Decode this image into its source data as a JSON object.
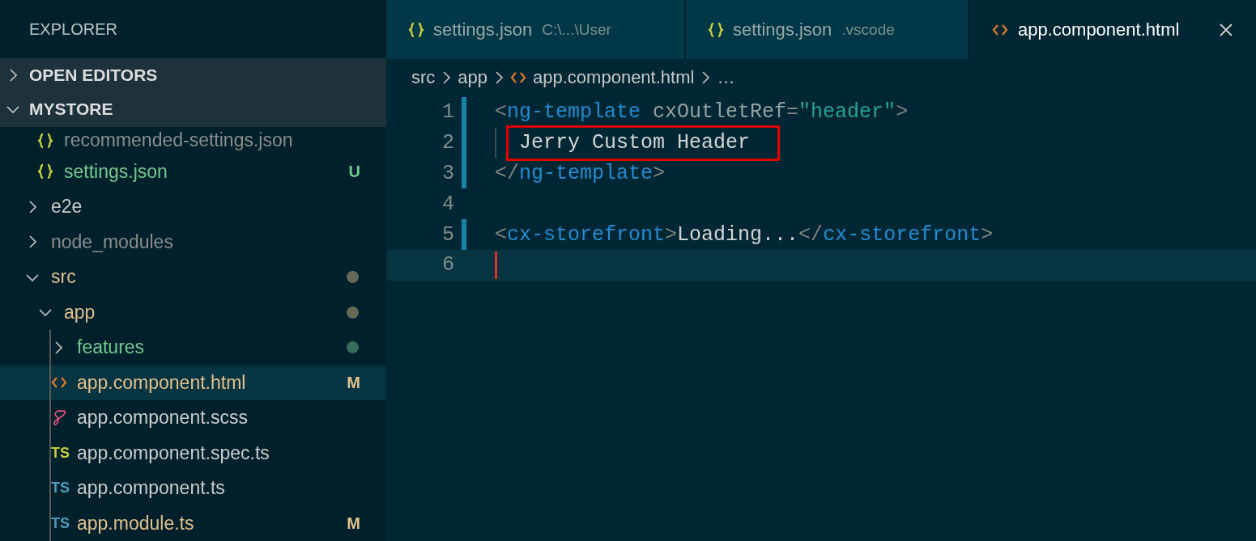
{
  "sidebar": {
    "title": "EXPLORER",
    "sections": [
      {
        "label": "OPEN EDITORS",
        "expanded": false
      },
      {
        "label": "MYSTORE",
        "expanded": true
      }
    ],
    "tree_continued": [
      {
        "name": "recommended-settings.json",
        "kind": "json-file",
        "color": "#8c8c8c",
        "selected": false
      },
      {
        "name": "settings.json",
        "kind": "json-file",
        "color": "#73c991",
        "badge": "U",
        "selected": false
      }
    ],
    "tree": [
      {
        "name": "e2e",
        "kind": "folder",
        "expanded": false,
        "color": "#cccccc",
        "selected": false
      },
      {
        "name": "node_modules",
        "kind": "folder",
        "expanded": false,
        "color": "#8c8c8c",
        "selected": false
      },
      {
        "name": "src",
        "kind": "folder",
        "expanded": true,
        "color": "#e2c08d",
        "dot": true,
        "selected": false,
        "children": [
          {
            "name": "app",
            "kind": "folder",
            "expanded": true,
            "color": "#e2c08d",
            "dot": true,
            "selected": false,
            "children": [
              {
                "name": "features",
                "kind": "folder",
                "expanded": false,
                "color": "#73c991",
                "dot": true,
                "selected": false
              },
              {
                "name": "app.component.html",
                "kind": "html-file",
                "color": "#e2c08d",
                "badge": "M",
                "selected": true
              },
              {
                "name": "app.component.scss",
                "kind": "scss-file",
                "color": "#cccccc",
                "selected": false
              },
              {
                "name": "app.component.spec.ts",
                "kind": "ts-spec-file",
                "icon_label": "TS",
                "color": "#cccccc",
                "selected": false
              },
              {
                "name": "app.component.ts",
                "kind": "ts-file",
                "icon_label": "TS",
                "color": "#cccccc",
                "selected": false
              },
              {
                "name": "app.module.ts",
                "kind": "ts-file",
                "icon_label": "TS",
                "color": "#e2c08d",
                "badge": "M",
                "selected": false
              }
            ]
          }
        ]
      }
    ]
  },
  "tabs": [
    {
      "label": "settings.json",
      "description": "C:\\...\\User",
      "kind": "json-file",
      "selected": false
    },
    {
      "label": "settings.json",
      "description": ".vscode",
      "kind": "json-file",
      "selected": false
    },
    {
      "label": "app.component.html",
      "kind": "html-file",
      "selected": true
    }
  ],
  "breadcrumb": [
    {
      "label": "src",
      "kind": "folder"
    },
    {
      "label": "app",
      "kind": "folder"
    },
    {
      "label": "app.component.html",
      "kind": "html-file"
    },
    {
      "label": "…",
      "kind": "more"
    }
  ],
  "code_lines": [
    {
      "number": "1",
      "changed": true,
      "tokens": [
        {
          "text": "<",
          "kind": "punct"
        },
        {
          "text": "ng-template",
          "kind": "tag"
        },
        {
          "text": " cxOutletRef",
          "kind": "attr"
        },
        {
          "text": "=",
          "kind": "punct"
        },
        {
          "text": "\"header\"",
          "kind": "string"
        },
        {
          "text": ">",
          "kind": "punct"
        }
      ]
    },
    {
      "number": "2",
      "changed": true,
      "indent_guide": true,
      "highlighted": true,
      "tokens": [
        {
          "text": "Jerry Custom Header",
          "kind": "text"
        }
      ]
    },
    {
      "number": "3",
      "changed": true,
      "tokens": [
        {
          "text": "</",
          "kind": "punct"
        },
        {
          "text": "ng-template",
          "kind": "tag"
        },
        {
          "text": ">",
          "kind": "punct"
        }
      ]
    },
    {
      "number": "4",
      "changed": false
    },
    {
      "number": "5",
      "changed": true,
      "tokens": [
        {
          "text": "<",
          "kind": "punct"
        },
        {
          "text": "cx-storefront",
          "kind": "tag"
        },
        {
          "text": ">",
          "kind": "punct"
        },
        {
          "text": "Loading...",
          "kind": "text"
        },
        {
          "text": "</",
          "kind": "punct"
        },
        {
          "text": "cx-storefront",
          "kind": "tag"
        },
        {
          "text": ">",
          "kind": "punct"
        }
      ]
    },
    {
      "number": "6",
      "changed": false,
      "current": true
    }
  ]
}
